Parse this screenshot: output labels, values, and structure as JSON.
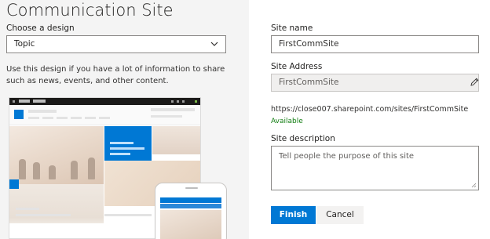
{
  "left": {
    "title": "Communication Site",
    "choose_label": "Choose a design",
    "design_select": {
      "value": "Topic"
    },
    "description": "Use this design if you have a lot of information to share such as news, events, and other content."
  },
  "form": {
    "site_name_label": "Site name",
    "site_name_value": "FirstCommSite",
    "site_address_label": "Site Address",
    "site_address_value": "FirstCommSite",
    "site_url": "https://close007.sharepoint.com/sites/FirstCommSite",
    "availability": "Available",
    "site_description_label": "Site description",
    "site_description_placeholder": "Tell people the purpose of this site",
    "finish_label": "Finish",
    "cancel_label": "Cancel"
  },
  "icons": {
    "select": "chevron-down-icon",
    "edit": "pencil-icon",
    "resize": "resize-grip-icon"
  },
  "colors": {
    "accent": "#0078d4",
    "available": "#107c10",
    "panel_bg": "#f4f4f4"
  }
}
